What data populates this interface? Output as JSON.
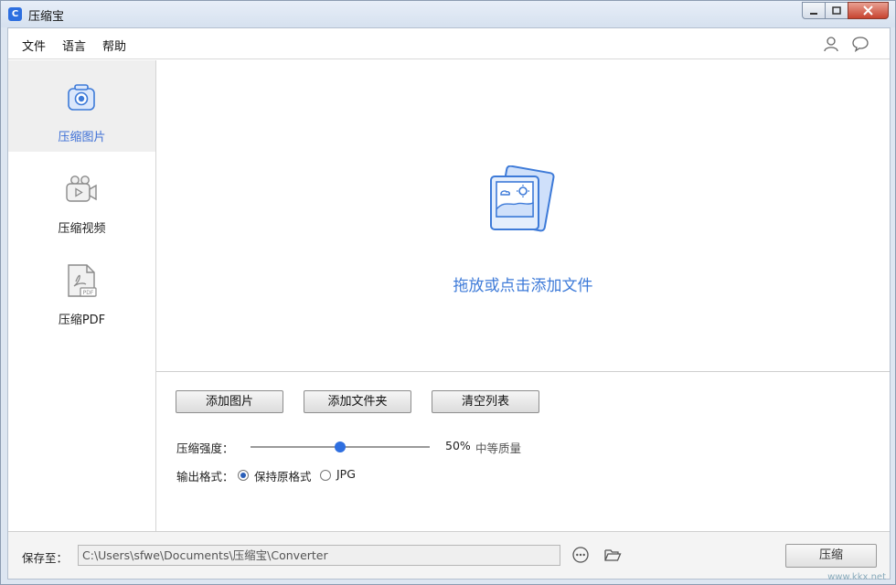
{
  "window": {
    "title": "压缩宝",
    "app_icon_glyph": "C"
  },
  "menu": {
    "items": [
      "文件",
      "语言",
      "帮助"
    ],
    "right_icons": [
      "user-icon",
      "chat-bubble-icon"
    ]
  },
  "sidebar": {
    "items": [
      {
        "label": "压缩图片",
        "icon": "camera-icon",
        "active": true
      },
      {
        "label": "压缩视频",
        "icon": "video-camera-icon",
        "active": false
      },
      {
        "label": "压缩PDF",
        "icon": "pdf-file-icon",
        "active": false
      }
    ]
  },
  "dropzone": {
    "text": "拖放或点击添加文件",
    "icon": "image-stack-icon"
  },
  "buttons": {
    "add_image": "添加图片",
    "add_folder": "添加文件夹",
    "clear_list": "清空列表"
  },
  "compression": {
    "label": "压缩强度：",
    "value": 50,
    "value_text": "50%",
    "quality_text": "中等质量"
  },
  "output": {
    "label": "输出格式：",
    "options": [
      {
        "label": "保持原格式",
        "checked": true
      },
      {
        "label": "JPG",
        "checked": false
      }
    ]
  },
  "footer": {
    "save_label": "保存至：",
    "path": "C:\\Users\\sfwe\\Documents\\压缩宝\\Converter",
    "compress_label": "压缩"
  },
  "watermark": {
    "url": "www.kkx.net"
  },
  "colors": {
    "accent": "#3d7ad8",
    "slider": "#2f6fe0"
  }
}
